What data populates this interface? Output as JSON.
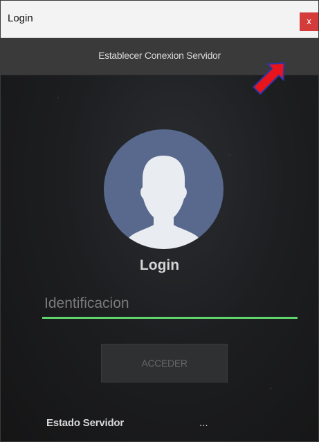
{
  "window": {
    "title": "Login",
    "close_label": "x"
  },
  "server_bar": {
    "label": "Establecer Conexion Servidor"
  },
  "annotation": {
    "arrow_color": "#e8141b"
  },
  "login": {
    "heading": "Login",
    "id_placeholder": "Identificacion",
    "id_value": "",
    "submit_label": "ACCEDER",
    "underline_color": "#5fd36c"
  },
  "status": {
    "label": "Estado Servidor",
    "value": "..."
  },
  "colors": {
    "avatar_bg": "#59698d",
    "avatar_silhouette": "#e9ecf1",
    "close_button": "#d43b3b"
  }
}
